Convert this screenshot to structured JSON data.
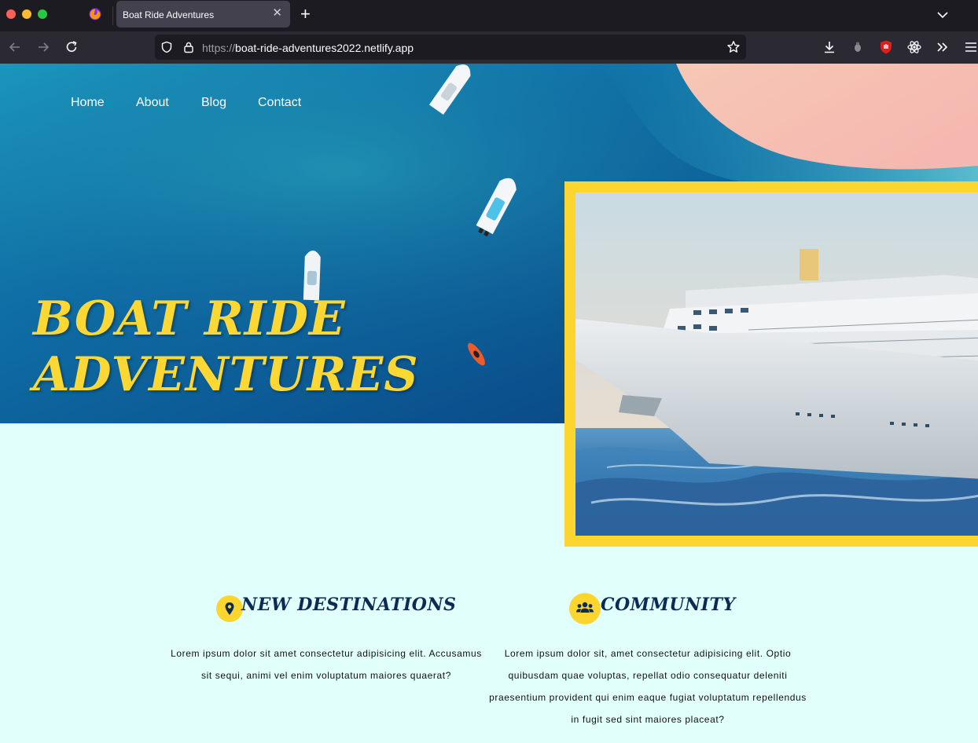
{
  "browser": {
    "tab_title": "Boat Ride Adventures",
    "close_glyph": "✕",
    "new_tab_glyph": "+",
    "url_protocol": "https://",
    "url_host": "boat-ride-adventures2022.netlify.app"
  },
  "nav": {
    "links": [
      "Home",
      "About",
      "Blog",
      "Contact"
    ]
  },
  "hero": {
    "title_line1": "BOAT RIDE",
    "title_line2": "ADVENTURES"
  },
  "features": [
    {
      "title": "NEW DESTINATIONS",
      "icon": "map-marker-icon",
      "text": "Lorem ipsum dolor sit amet consectetur adipisicing elit. Accusamus sit sequi, animi vel enim voluptatum maiores quaerat?"
    },
    {
      "title": "COMMUNITY",
      "icon": "users-icon",
      "text": "Lorem ipsum dolor sit, amet consectetur adipisicing elit. Optio quibusdam quae voluptas, repellat odio consequatur deleniti praesentium provident qui enim eaque fugiat voluptatum repellendus in fugit sed sint maiores placeat?"
    }
  ],
  "colors": {
    "accent_yellow": "#fdd835",
    "page_bg": "#e1fffb",
    "heading_navy": "#0b2a55"
  }
}
